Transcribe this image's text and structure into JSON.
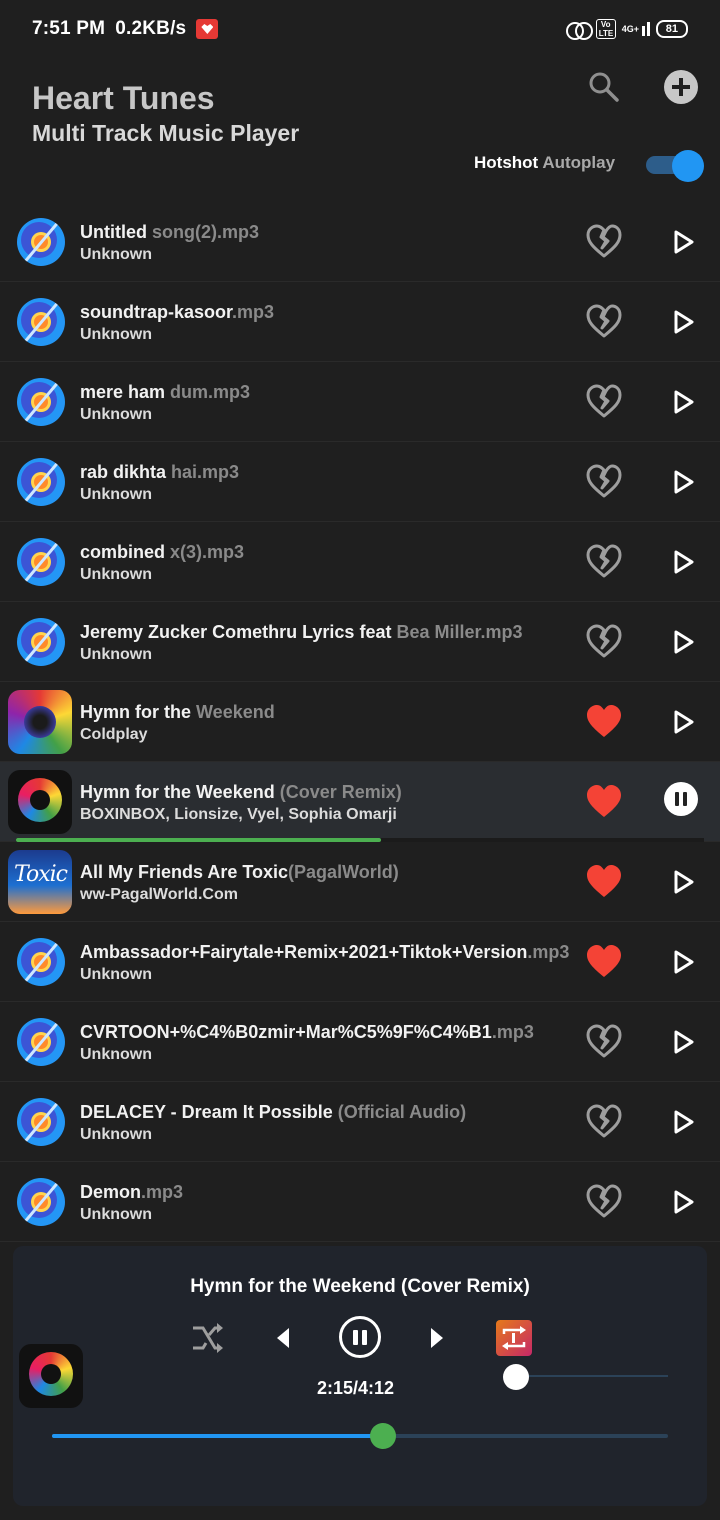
{
  "status_bar": {
    "time": "7:51 PM",
    "speed": "0.2KB/s",
    "volte": "Vo LTE",
    "network": "4G+",
    "battery": "81"
  },
  "header": {
    "title": "Heart Tunes",
    "subtitle": "Multi Track Music Player",
    "autoplay_label_primary": "Hotshot",
    "autoplay_label_secondary": "Autoplay",
    "autoplay_on": true
  },
  "colors": {
    "accent": "#2196f3",
    "favorite": "#f44336",
    "progress": "#4caf50"
  },
  "tracks": [
    {
      "title_a": "Untitled",
      "title_b": " song(2).mp3",
      "artist": "Unknown",
      "art": "disc",
      "favorite": false,
      "state": "play"
    },
    {
      "title_a": "soundtrap-kasoor",
      "title_b": ".mp3",
      "artist": "Unknown",
      "art": "disc",
      "favorite": false,
      "state": "play"
    },
    {
      "title_a": "mere ham",
      "title_b": " dum.mp3",
      "artist": "Unknown",
      "art": "disc",
      "favorite": false,
      "state": "play"
    },
    {
      "title_a": "rab dikhta",
      "title_b": " hai.mp3",
      "artist": "Unknown",
      "art": "disc",
      "favorite": false,
      "state": "play"
    },
    {
      "title_a": "combined",
      "title_b": " x(3).mp3",
      "artist": "Unknown",
      "art": "disc",
      "favorite": false,
      "state": "play"
    },
    {
      "title_a": "Jeremy Zucker Comethru Lyrics feat",
      "title_b": " Bea Miller.mp3",
      "artist": "Unknown",
      "art": "disc",
      "favorite": false,
      "state": "play"
    },
    {
      "title_a": "Hymn for the",
      "title_b": " Weekend",
      "artist": "Coldplay",
      "art": "coldplay",
      "favorite": true,
      "state": "play"
    },
    {
      "title_a": "Hymn for the Weekend",
      "title_b": " (Cover Remix)",
      "artist": "BOXINBOX, Lionsize, Vyel, Sophia Omarji",
      "art": "remix",
      "favorite": true,
      "state": "playing",
      "progress": 0.53
    },
    {
      "title_a": "All My Friends Are Toxic",
      "title_b": "(PagalWorld)",
      "artist": "ww-PagalWorld.Com",
      "art": "toxic",
      "favorite": true,
      "state": "play"
    },
    {
      "title_a": "Ambassador+Fairytale+Remix+2021+Tiktok+Version",
      "title_b": ".mp3",
      "artist": "Unknown",
      "art": "disc",
      "favorite": true,
      "state": "play"
    },
    {
      "title_a": "CVRTOON+%C4%B0zmir+Mar%C5%9F%C4%B1",
      "title_b": ".mp3",
      "artist": "Unknown",
      "art": "disc",
      "favorite": false,
      "state": "play"
    },
    {
      "title_a": "DELACEY - Dream It Possible",
      "title_b": " (Official Audio)",
      "artist": "Unknown",
      "art": "disc",
      "favorite": false,
      "state": "play"
    },
    {
      "title_a": "Demon",
      "title_b": ".mp3",
      "artist": "Unknown",
      "art": "disc",
      "favorite": false,
      "state": "play"
    }
  ],
  "player": {
    "title": "Hymn for the Weekend (Cover Remix)",
    "time": "2:15/4:12",
    "seek_fraction": 0.537,
    "volume_fraction": 0.0,
    "icons": [
      "shuffle-icon",
      "previous-icon",
      "pause-icon",
      "next-icon",
      "repeat-one-icon"
    ]
  }
}
